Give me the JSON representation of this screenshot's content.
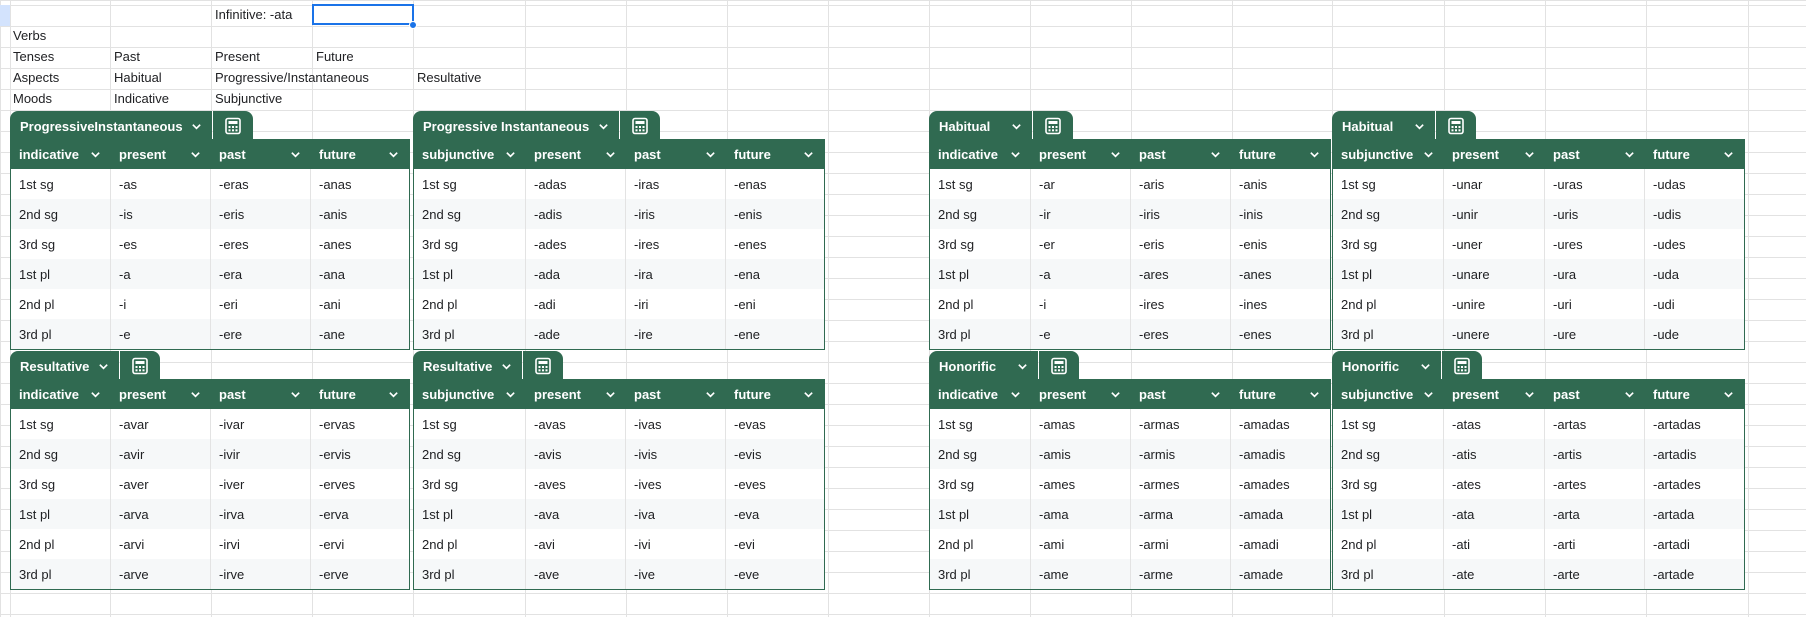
{
  "cells": {
    "infinitive": "Infinitive: -ata",
    "verbs": "Verbs",
    "tenses_label": "Tenses",
    "tenses": [
      "Past",
      "Present",
      "Future"
    ],
    "aspects_label": "Aspects",
    "aspects": [
      "Habitual",
      "Progressive/Instantaneous",
      "Resultative"
    ],
    "moods_label": "Moods",
    "moods": [
      "Indicative",
      "Subjunctive"
    ]
  },
  "tables": [
    {
      "name": "ProgressiveInstantaneous",
      "columns": [
        "indicative",
        "present",
        "past",
        "future"
      ],
      "rows": [
        [
          "1st sg",
          "-as",
          "-eras",
          "-anas"
        ],
        [
          "2nd sg",
          "-is",
          "-eris",
          "-anis"
        ],
        [
          "3rd sg",
          "-es",
          "-eres",
          "-anes"
        ],
        [
          "1st pl",
          "-a",
          "-era",
          "-ana"
        ],
        [
          "2nd pl",
          "-i",
          "-eri",
          "-ani"
        ],
        [
          "3rd pl",
          "-e",
          "-ere",
          "-ane"
        ]
      ]
    },
    {
      "name": "Progressive Instantaneous",
      "columns": [
        "subjunctive",
        "present",
        "past",
        "future"
      ],
      "rows": [
        [
          "1st sg",
          "-adas",
          "-iras",
          "-enas"
        ],
        [
          "2nd sg",
          "-adis",
          "-iris",
          "-enis"
        ],
        [
          "3rd sg",
          "-ades",
          "-ires",
          "-enes"
        ],
        [
          "1st pl",
          "-ada",
          "-ira",
          "-ena"
        ],
        [
          "2nd pl",
          "-adi",
          "-iri",
          "-eni"
        ],
        [
          "3rd pl",
          "-ade",
          "-ire",
          "-ene"
        ]
      ]
    },
    {
      "name": "Habitual",
      "columns": [
        "indicative",
        "present",
        "past",
        "future"
      ],
      "rows": [
        [
          "1st sg",
          "-ar",
          "-aris",
          "-anis"
        ],
        [
          "2nd sg",
          "-ir",
          "-iris",
          "-inis"
        ],
        [
          "3rd sg",
          "-er",
          "-eris",
          "-enis"
        ],
        [
          "1st pl",
          "-a",
          "-ares",
          "-anes"
        ],
        [
          "2nd pl",
          "-i",
          "-ires",
          "-ines"
        ],
        [
          "3rd pl",
          "-e",
          "-eres",
          "-enes"
        ]
      ]
    },
    {
      "name": "Habitual",
      "columns": [
        "subjunctive",
        "present",
        "past",
        "future"
      ],
      "rows": [
        [
          "1st sg",
          "-unar",
          "-uras",
          "-udas"
        ],
        [
          "2nd sg",
          "-unir",
          "-uris",
          "-udis"
        ],
        [
          "3rd sg",
          "-uner",
          "-ures",
          "-udes"
        ],
        [
          "1st pl",
          "-unare",
          "-ura",
          "-uda"
        ],
        [
          "2nd pl",
          "-unire",
          "-uri",
          "-udi"
        ],
        [
          "3rd pl",
          "-unere",
          "-ure",
          "-ude"
        ]
      ]
    },
    {
      "name": "Resultative",
      "columns": [
        "indicative",
        "present",
        "past",
        "future"
      ],
      "rows": [
        [
          "1st sg",
          "-avar",
          "-ivar",
          "-ervas"
        ],
        [
          "2nd sg",
          "-avir",
          "-ivir",
          "-ervis"
        ],
        [
          "3rd sg",
          "-aver",
          "-iver",
          "-erves"
        ],
        [
          "1st pl",
          "-arva",
          "-irva",
          "-erva"
        ],
        [
          "2nd pl",
          "-arvi",
          "-irvi",
          "-ervi"
        ],
        [
          "3rd pl",
          "-arve",
          "-irve",
          "-erve"
        ]
      ]
    },
    {
      "name": "Resultative",
      "columns": [
        "subjunctive",
        "present",
        "past",
        "future"
      ],
      "rows": [
        [
          "1st sg",
          "-avas",
          "-ivas",
          "-evas"
        ],
        [
          "2nd sg",
          "-avis",
          "-ivis",
          "-evis"
        ],
        [
          "3rd sg",
          "-aves",
          "-ives",
          "-eves"
        ],
        [
          "1st pl",
          "-ava",
          "-iva",
          "-eva"
        ],
        [
          "2nd pl",
          "-avi",
          "-ivi",
          "-evi"
        ],
        [
          "3rd pl",
          "-ave",
          "-ive",
          "-eve"
        ]
      ]
    },
    {
      "name": "Honorific",
      "columns": [
        "indicative",
        "present",
        "past",
        "future"
      ],
      "rows": [
        [
          "1st sg",
          "-amas",
          "-armas",
          "-amadas"
        ],
        [
          "2nd sg",
          "-amis",
          "-armis",
          "-amadis"
        ],
        [
          "3rd sg",
          "-ames",
          "-armes",
          "-amades"
        ],
        [
          "1st pl",
          "-ama",
          "-arma",
          "-amada"
        ],
        [
          "2nd pl",
          "-ami",
          "-armi",
          "-amadi"
        ],
        [
          "3rd pl",
          "-ame",
          "-arme",
          "-amade"
        ]
      ]
    },
    {
      "name": "Honorific",
      "columns": [
        "subjunctive",
        "present",
        "past",
        "future"
      ],
      "rows": [
        [
          "1st sg",
          "-atas",
          "-artas",
          "-artadas"
        ],
        [
          "2nd sg",
          "-atis",
          "-artis",
          "-artadis"
        ],
        [
          "3rd sg",
          "-ates",
          "-artes",
          "-artades"
        ],
        [
          "1st pl",
          "-ata",
          "-arta",
          "-artada"
        ],
        [
          "2nd pl",
          "-ati",
          "-arti",
          "-artadi"
        ],
        [
          "3rd pl",
          "-ate",
          "-arte",
          "-artade"
        ]
      ]
    }
  ],
  "colors": {
    "table_header": "#306a51",
    "selection": "#1a73e8",
    "gridline": "#e2e2e2"
  }
}
